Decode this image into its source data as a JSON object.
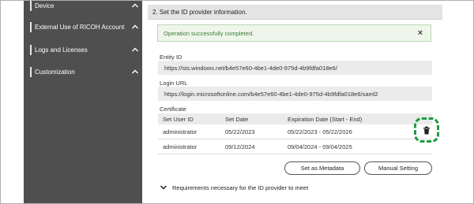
{
  "sidebar": {
    "items": [
      {
        "label": "Device"
      },
      {
        "label": "External Use of RICOH Account"
      },
      {
        "label": "Logs and Licenses"
      },
      {
        "label": "Customization"
      }
    ]
  },
  "section": {
    "title": "2. Set the ID provider information."
  },
  "alert": {
    "message": "Operation successfully completed.",
    "close": "×"
  },
  "entity_id": {
    "label": "Entity ID",
    "value": "https://sts.windows.net/b4e57e60-4be1-4de0-975d-4b9fdfa018e6/"
  },
  "login_url": {
    "label": "Login URL",
    "value": "https://login.microsoftonline.com/b4e57e60-4be1-4de0-975d-4b9fdfa018e6/saml2"
  },
  "certificate": {
    "label": "Certificate",
    "columns": [
      "Set User ID",
      "Set Date",
      "Expiration Date (Start - End)"
    ],
    "rows": [
      [
        "administrator",
        "05/22/2023",
        "05/22/2023 - 05/22/2026"
      ],
      [
        "administrator",
        "09/12/2024",
        "09/04/2024 - 09/04/2025"
      ]
    ]
  },
  "buttons": {
    "set_metadata": "Set as Metadata",
    "manual_setting": "Manual Setting"
  },
  "requirements": {
    "label": "Requirements necessary for the ID provider to meet"
  },
  "colors": {
    "sidebar": "#4f4f4f",
    "success_text": "#3d7a35",
    "highlight": "#1e9a3d"
  }
}
